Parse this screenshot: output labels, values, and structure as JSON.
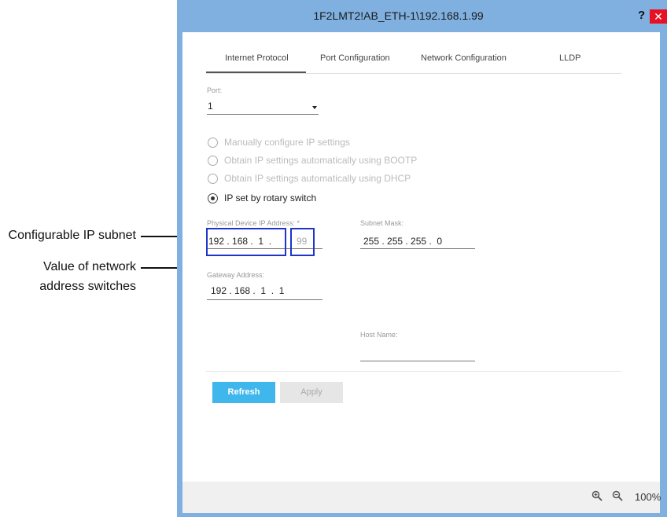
{
  "annotations": {
    "subnet_callout": "Configurable IP subnet",
    "switch_callout_line1": "Value of network",
    "switch_callout_line2": "address switches"
  },
  "window": {
    "title": "1F2LMT2!AB_ETH-1\\192.168.1.99",
    "help_label": "?",
    "close_label": "✕"
  },
  "tabs": [
    {
      "label": "Internet Protocol",
      "active": true
    },
    {
      "label": "Port Configuration",
      "active": false
    },
    {
      "label": "Network Configuration",
      "active": false
    },
    {
      "label": "LLDP",
      "active": false
    }
  ],
  "port": {
    "label": "Port:",
    "value": "1",
    "dropdown_icon": "caret-down"
  },
  "radios": [
    {
      "label": "Manually configure IP settings",
      "checked": false,
      "enabled": false
    },
    {
      "label": "Obtain IP settings automatically using BOOTP",
      "checked": false,
      "enabled": false
    },
    {
      "label": "Obtain IP settings automatically using DHCP",
      "checked": false,
      "enabled": false
    },
    {
      "label": "IP set by rotary switch",
      "checked": true,
      "enabled": true
    }
  ],
  "fields": {
    "ip_label": "Physical Device IP Address: *",
    "ip_value": "192 . 168 .  1  .",
    "ip_last_octet": "99",
    "subnet_label": "Subnet Mask:",
    "subnet_value": "255 . 255 . 255 .  0",
    "gateway_label": "Gateway Address:",
    "gateway_value": "192 . 168 .  1  .  1",
    "host_label": "Host Name:",
    "host_value": ""
  },
  "buttons": {
    "refresh": "Refresh",
    "apply": "Apply"
  },
  "footer": {
    "zoom_in_icon": "zoom-in",
    "zoom_out_icon": "zoom-out",
    "zoom_level": "100%"
  },
  "colors": {
    "accent": "#3fb6ec",
    "highlight_box": "#1d35c8",
    "title_bar": "#7fb0e0",
    "close": "#e81123"
  }
}
